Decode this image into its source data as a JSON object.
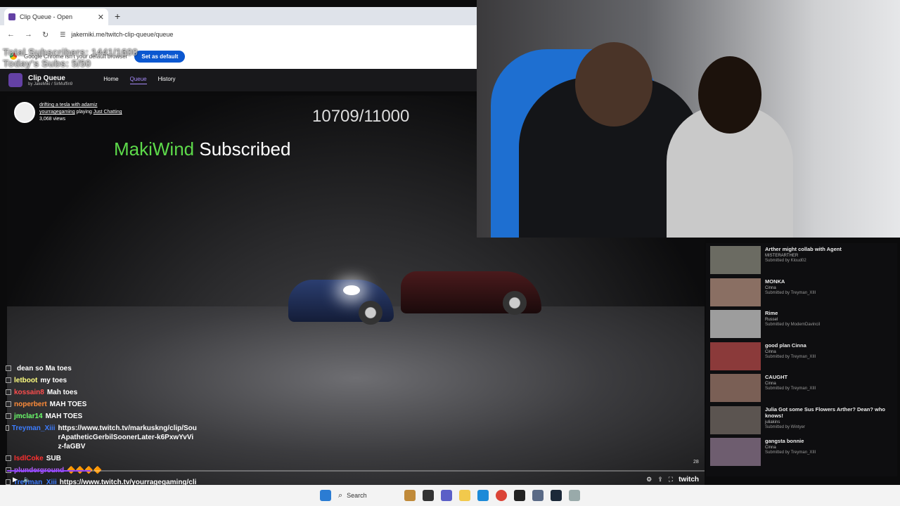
{
  "browser": {
    "tab_title": "Clip Queue - Open",
    "tab_close": "✕",
    "new_tab": "+",
    "back": "←",
    "forward": "→",
    "reload": "↻",
    "url": "jakemiki.me/twitch-clip-queue/queue",
    "infobar_text": "Google Chrome isn't your default browser",
    "set_default_label": "Set as default"
  },
  "overlay": {
    "total_subs": "Total Subscribers: 1441/1600",
    "todays_subs": "Today's Subs: 5/50"
  },
  "clip_queue": {
    "brand": "Clip Queue",
    "byline": "by JakeMiki / SirMuffin9",
    "nav": [
      "Home",
      "Queue",
      "History"
    ]
  },
  "current_clip": {
    "title": "drifting a tesla with adamiz",
    "channel": "yourragegaming",
    "playing_label": "playing",
    "game": "Just Chatting",
    "views": "3,068 views"
  },
  "sub_counter": "10709/11000",
  "sub_alert": {
    "user": "MakiWind",
    "text": "Subscribed"
  },
  "chat": [
    {
      "user": "",
      "text": "dean so Ma toes",
      "color": "#ffffff"
    },
    {
      "user": "letboot",
      "text": "my toes",
      "color": "#ffff80"
    },
    {
      "user": "kossain8",
      "text": "Mah toes",
      "color": "#ff4d4d"
    },
    {
      "user": "noperbert",
      "text": "MAH TOES",
      "color": "#ff8c3a"
    },
    {
      "user": "jmclar14",
      "text": "MAH TOES",
      "color": "#6cff6c"
    },
    {
      "user": "Treyman_Xiii",
      "text": "https://www.twitch.tv/markuskng/clip/SourApatheticGerbilSoonerLater-k6PxwYvViz-faGBV",
      "color": "#3d7dff"
    },
    {
      "user": "IsdlCoke",
      "text": "SUB",
      "color": "#ff3030"
    },
    {
      "user": "plunderground",
      "text": "🔶🔶🔶🔶",
      "color": "#b15cff"
    },
    {
      "user": "Treyman_Xiii",
      "text": "https://www.twitch.tv/yourragegaming/clip/Clean",
      "color": "#3d7dff"
    }
  ],
  "player": {
    "play": "▶",
    "volume": "🔈",
    "gear": "⚙",
    "share": "⇪",
    "fullscreen": "⛶",
    "brand": "twitch",
    "counter": "28",
    "progress": 0.12
  },
  "queue": [
    {
      "title": "Arther might collab with Agent",
      "channel": "MISTERARTHER",
      "submitted": "Submitted by Kloud02",
      "thumb": "#6b6b62"
    },
    {
      "title": "MONKA",
      "channel": "Cinna",
      "submitted": "Submitted by Treyman_XIII",
      "thumb": "#8a6f63"
    },
    {
      "title": "Rime",
      "channel": "Russel",
      "submitted": "Submitted by ModernDavinciI",
      "thumb": "#9d9d9d"
    },
    {
      "title": "good plan Cinna",
      "channel": "Cinna",
      "submitted": "Submitted by Treyman_XIII",
      "thumb": "#8b3a3a"
    },
    {
      "title": "CAUGHT",
      "channel": "Cinna",
      "submitted": "Submitted by Treyman_XIII",
      "thumb": "#7a5f55"
    },
    {
      "title": "Julia Got some Sus Flowers Arther? Dean? who knows!",
      "channel": "juliakins",
      "submitted": "Submitted by Wintyer",
      "thumb": "#5b5450"
    },
    {
      "title": "gangsta bonnie",
      "channel": "Cinna",
      "submitted": "Submitted by Treyman_XIII",
      "thumb": "#6e5d6f"
    }
  ],
  "taskbar": {
    "search_label": "Search",
    "search_icon": "⌕"
  }
}
